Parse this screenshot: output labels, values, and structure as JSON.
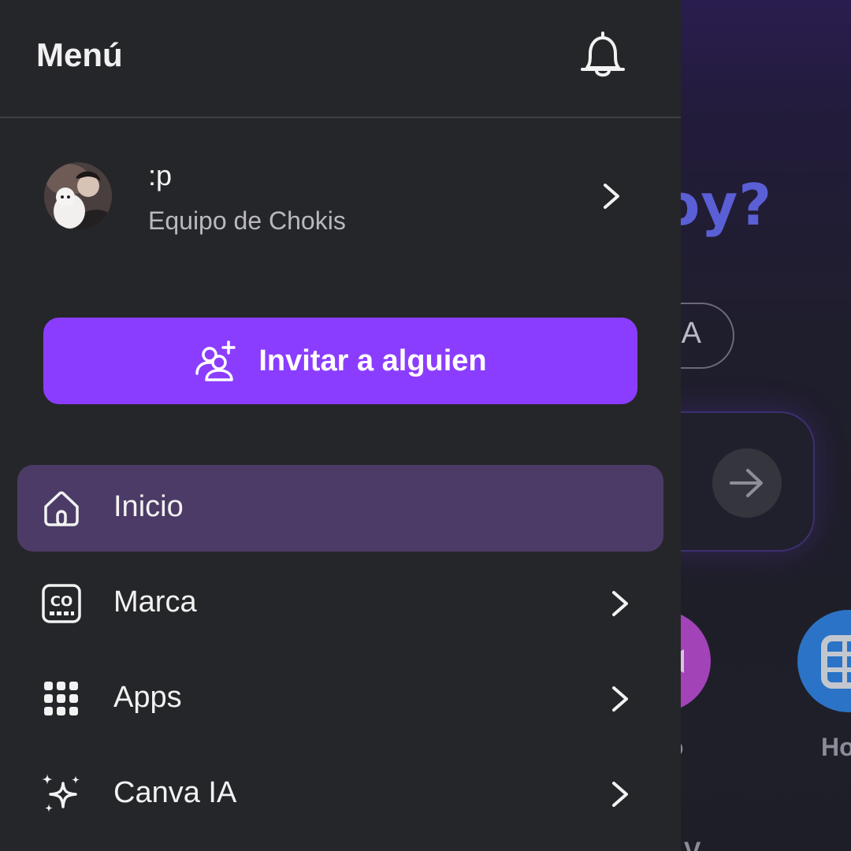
{
  "background": {
    "heading_fragment": "oy?",
    "chip_fragment": "IA",
    "label_fragment_1": "o",
    "label_fragment_2": "Ho",
    "label_fragment_3": "V"
  },
  "drawer": {
    "title": "Menú",
    "notifications_icon": "bell-icon",
    "profile": {
      "name": ":p",
      "team": "Equipo de Chokis"
    },
    "invite_button": {
      "label": "Invitar a alguien",
      "icon": "add-user-icon",
      "color": "#8b3dff"
    },
    "nav": [
      {
        "label": "Inicio",
        "icon": "home-icon",
        "active": true
      },
      {
        "label": "Marca",
        "icon": "brand-kit-icon",
        "active": false
      },
      {
        "label": "Apps",
        "icon": "apps-grid-icon",
        "active": false
      },
      {
        "label": "Canva IA",
        "icon": "sparkles-icon",
        "active": false
      }
    ],
    "active_color": "#4c3b67"
  }
}
